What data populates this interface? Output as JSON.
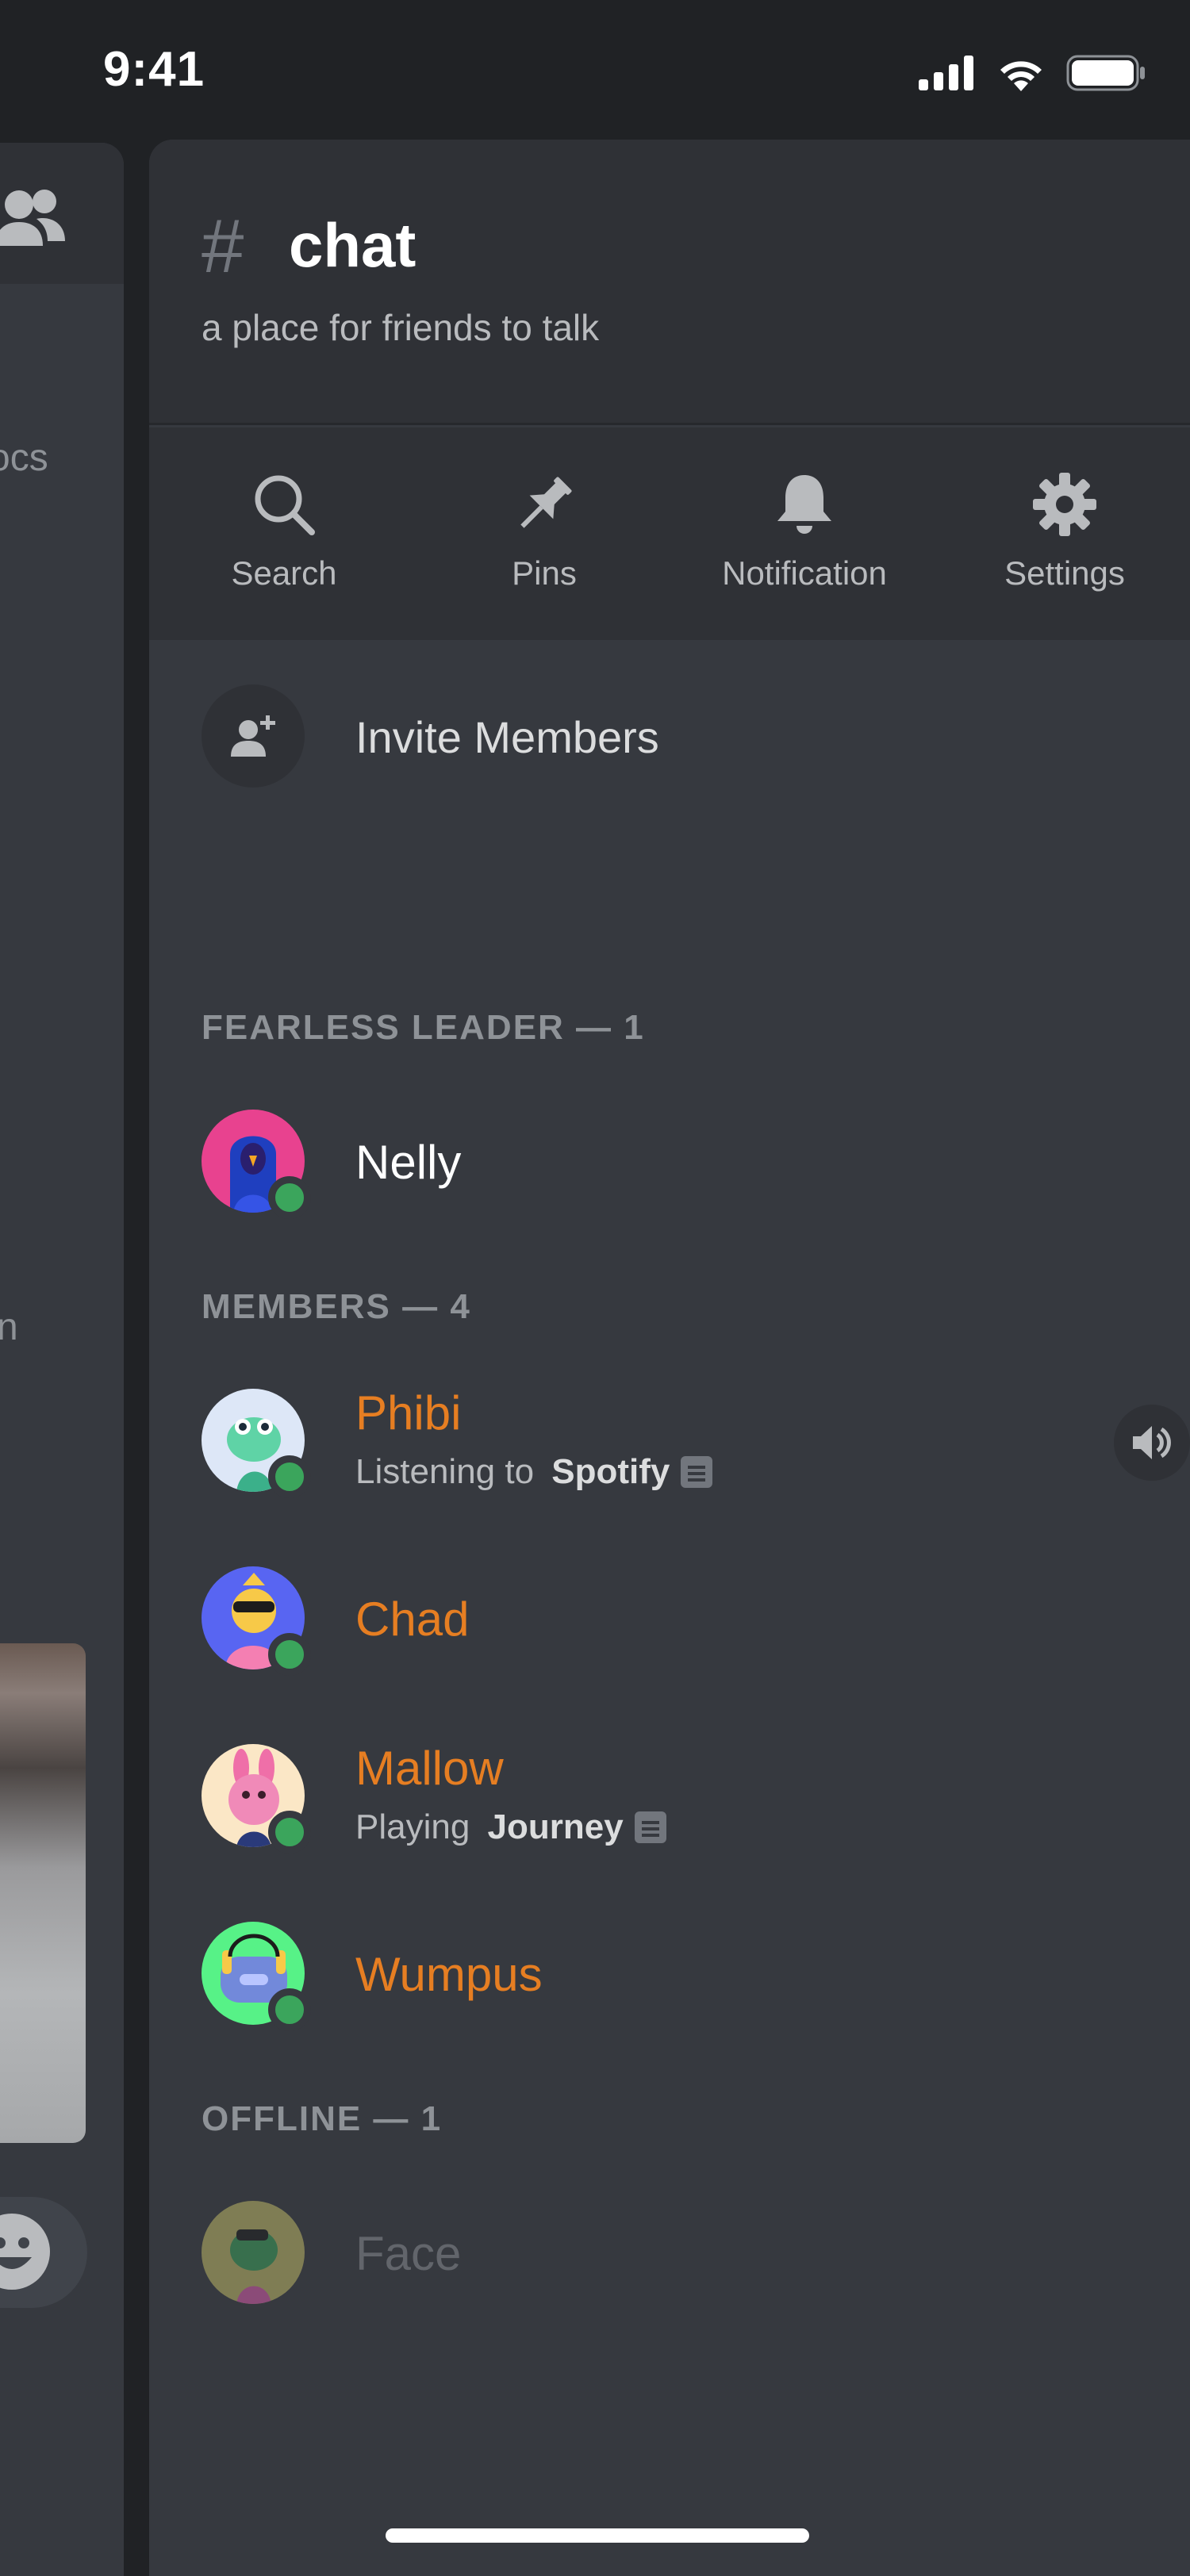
{
  "status_bar": {
    "time": "9:41"
  },
  "background_panel": {
    "partial_text_1": "ocs",
    "partial_text_2": "n"
  },
  "channel": {
    "hash_symbol": "#",
    "name": "chat",
    "topic": "a place for friends to talk"
  },
  "toolbar": {
    "search_label": "Search",
    "pins_label": "Pins",
    "notification_label": "Notification",
    "settings_label": "Settings"
  },
  "invite": {
    "label": "Invite Members"
  },
  "sections": {
    "leader_header": "FEARLESS LEADER — 1",
    "members_header": "MEMBERS — 4",
    "offline_header": "OFFLINE — 1"
  },
  "leader": {
    "name": "Nelly",
    "status": "online"
  },
  "members": [
    {
      "name": "Phibi",
      "status": "online",
      "activity_prefix": "Listening to",
      "activity_name": "Spotify",
      "in_voice": true
    },
    {
      "name": "Chad",
      "status": "online"
    },
    {
      "name": "Mallow",
      "status": "online",
      "activity_prefix": "Playing",
      "activity_name": "Journey"
    },
    {
      "name": "Wumpus",
      "status": "online"
    }
  ],
  "offline": [
    {
      "name": "Face"
    }
  ],
  "colors": {
    "background": "#202225",
    "panel": "#36393f",
    "header": "#2f3136",
    "member_name": "#e67e22",
    "online": "#3ba55c",
    "muted_text": "#b9bbbe"
  }
}
